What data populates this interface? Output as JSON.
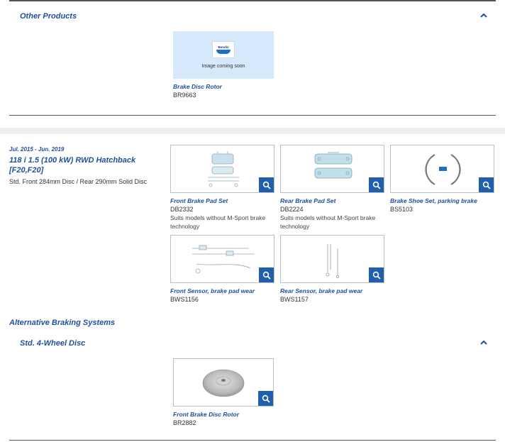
{
  "sections": {
    "other_products": "Other Products",
    "alt_braking": "Alternative Braking Systems",
    "std_4_wheel": "Std. 4-Wheel Disc"
  },
  "placeholder": {
    "logo_text": "Bendix",
    "coming_soon": "Image coming soon"
  },
  "other_products": [
    {
      "name": "Brake Disc Rotor",
      "code": "BR9663"
    }
  ],
  "vehicle": {
    "date_range": "Jul. 2015 - Jun. 2019",
    "model": "118 i 1.5 (100 kW) RWD Hatchback [F20,F20]",
    "description": "Std. Front 284mm Disc / Rear 290mm Solid Disc"
  },
  "vehicle_products": [
    {
      "name": "Front Brake Pad Set",
      "code": "DB2332",
      "note": "Suits models without M-Sport brake technology"
    },
    {
      "name": "Rear Brake Pad Set",
      "code": "DB2224",
      "note": "Suits models without M-Sport brake technology"
    },
    {
      "name": "Brake Shoe Set, parking brake",
      "code": "BS5103",
      "note": ""
    },
    {
      "name": "Front Sensor, brake pad wear",
      "code": "BWS1156",
      "note": ""
    },
    {
      "name": "Rear Sensor, brake pad wear",
      "code": "BWS1157",
      "note": ""
    }
  ],
  "alt_products": [
    {
      "name": "Front Brake Disc Rotor",
      "code": "BR2882"
    }
  ],
  "colors": {
    "accent": "#1f4f9c",
    "button": "#1f5fae",
    "placeholder_bg": "#d6e8fb"
  },
  "icons": {
    "collapse": "chevron-up-icon",
    "zoom": "magnify-icon"
  }
}
